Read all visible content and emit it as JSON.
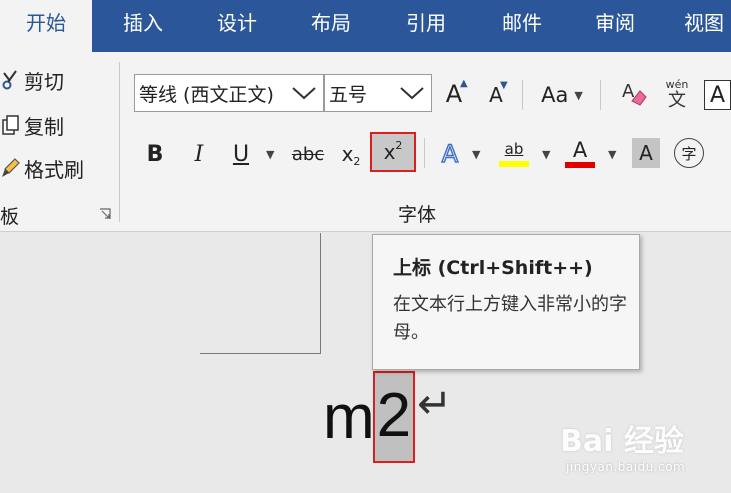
{
  "tabs": [
    {
      "label": "开始",
      "active": true
    },
    {
      "label": "插入"
    },
    {
      "label": "设计"
    },
    {
      "label": "布局"
    },
    {
      "label": "引用"
    },
    {
      "label": "邮件"
    },
    {
      "label": "审阅"
    },
    {
      "label": "视图"
    }
  ],
  "clipboard": {
    "cut_label": "剪切",
    "copy_label": "复制",
    "format_painter_label": "格式刷",
    "group_label": "板"
  },
  "font": {
    "font_name": "等线 (西文正文)",
    "font_size": "五号",
    "group_label": "字体",
    "grow_label": "A",
    "shrink_label": "A",
    "change_case_label": "Aa",
    "bold_label": "B",
    "italic_label": "I",
    "underline_label": "U",
    "strike_label": "abc",
    "subscript_label": "x",
    "subscript_digit": "2",
    "superscript_label": "x",
    "superscript_digit": "2",
    "text_effects_label": "A",
    "highlight_label": "ab",
    "font_color_label": "A",
    "char_shading_label": "A",
    "enclose_label": "字",
    "phonetic_top": "wén",
    "phonetic_bottom": "文",
    "border_label": "A"
  },
  "tooltip": {
    "title": "上标 (Ctrl+Shift++)",
    "description": "在文本行上方键入非常小的字母。"
  },
  "document": {
    "text_before": "m",
    "selected_text": "2",
    "paragraph_mark": "↵"
  },
  "watermark": {
    "brand": "Bai 经验",
    "url": "jingyan.baidu.com"
  },
  "colors": {
    "tab_bar": "#2b579a",
    "ribbon": "#f3f3f3",
    "highlight_red": "#d91f1f",
    "highlighter_yellow": "#ffff00",
    "text_effects_blue": "#4472c4"
  }
}
